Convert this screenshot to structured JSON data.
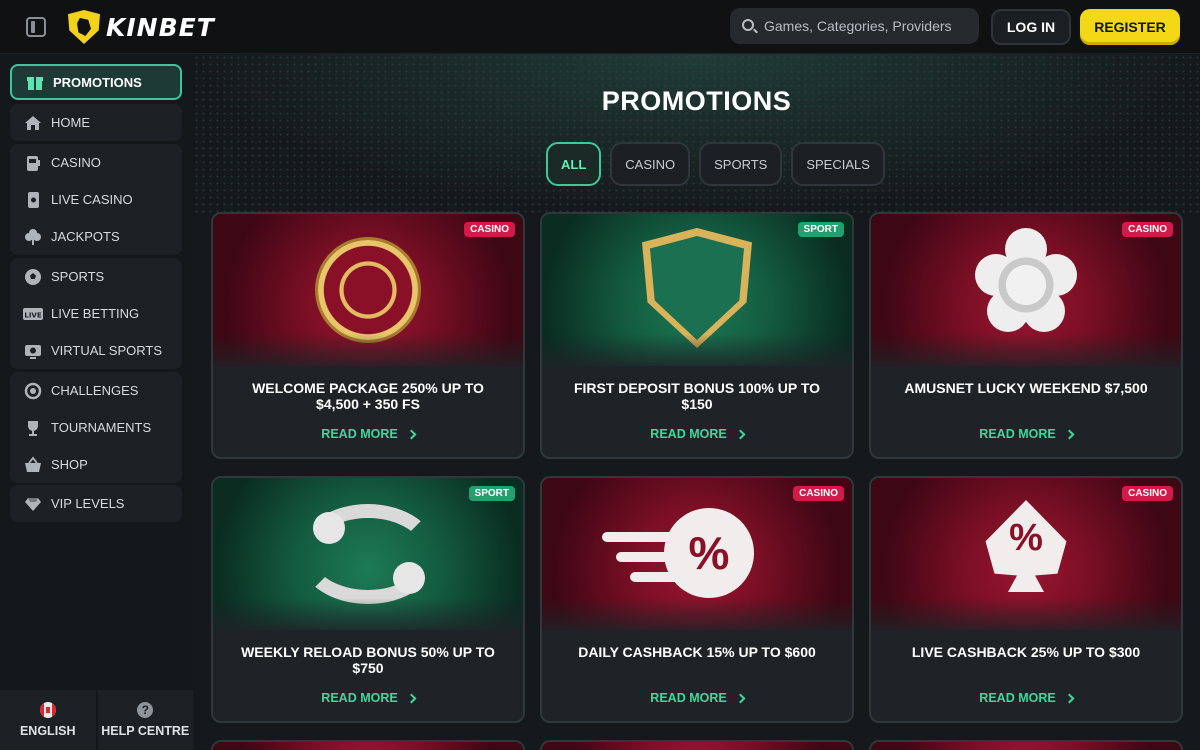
{
  "header": {
    "brand": "KINBET",
    "search_placeholder": "Games, Categories, Providers",
    "login_label": "LOG IN",
    "register_label": "REGISTER"
  },
  "sidebar": {
    "groups": [
      [
        {
          "label": "PROMOTIONS",
          "icon": "gift-icon",
          "active": true
        }
      ],
      [
        {
          "label": "HOME",
          "icon": "home-icon"
        }
      ],
      [
        {
          "label": "CASINO",
          "icon": "slot-machine-icon"
        },
        {
          "label": "LIVE CASINO",
          "icon": "playing-card-icon"
        },
        {
          "label": "JACKPOTS",
          "icon": "clover-icon"
        }
      ],
      [
        {
          "label": "SPORTS",
          "icon": "soccer-ball-icon"
        },
        {
          "label": "LIVE BETTING",
          "icon": "live-icon"
        },
        {
          "label": "VIRTUAL SPORTS",
          "icon": "virtual-sports-icon"
        }
      ],
      [
        {
          "label": "CHALLENGES",
          "icon": "challenge-icon"
        },
        {
          "label": "TOURNAMENTS",
          "icon": "trophy-icon"
        },
        {
          "label": "SHOP",
          "icon": "shopping-basket-icon"
        }
      ],
      [
        {
          "label": "VIP LEVELS",
          "icon": "diamond-icon"
        }
      ]
    ],
    "language_label": "ENGLISH",
    "help_label": "HELP CENTRE",
    "help_glyph": "?"
  },
  "main": {
    "title": "PROMOTIONS",
    "filters": [
      "ALL",
      "CASINO",
      "SPORTS",
      "SPECIALS"
    ],
    "active_filter": "ALL",
    "read_more_label": "READ MORE",
    "promos": [
      {
        "title": "WELCOME PACKAGE 250% UP TO $4,500 + 350 FS",
        "badge": "CASINO",
        "theme": "red"
      },
      {
        "title": "FIRST DEPOSIT BONUS 100% UP TO $150",
        "badge": "SPORT",
        "theme": "green"
      },
      {
        "title": "AMUSNET LUCKY WEEKEND $7,500",
        "badge": "CASINO",
        "theme": "red"
      },
      {
        "title": "WEEKLY RELOAD BONUS 50% UP TO $750",
        "badge": "SPORT",
        "theme": "green"
      },
      {
        "title": "DAILY CASHBACK 15% UP TO $600",
        "badge": "CASINO",
        "theme": "red"
      },
      {
        "title": "LIVE CASHBACK 25% UP TO $300",
        "badge": "CASINO",
        "theme": "red"
      }
    ],
    "art_glyph_percent": "%"
  },
  "colors": {
    "accent_green": "#3fd89c",
    "register_yellow": "#f3d818",
    "casino_badge": "#d31a4a",
    "sport_badge": "#23a06f"
  }
}
